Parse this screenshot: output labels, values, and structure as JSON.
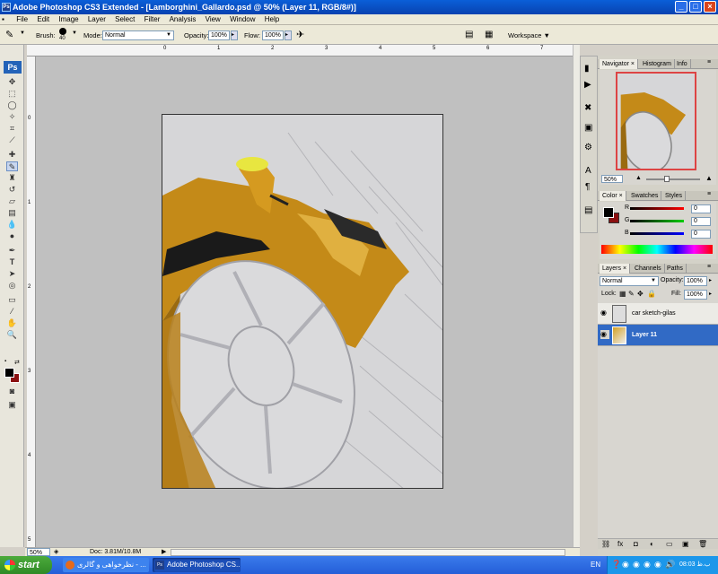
{
  "window": {
    "title": "Adobe Photoshop CS3 Extended - [Lamborghini_Gallardo.psd @ 50% (Layer 11, RGB/8#)]"
  },
  "menu": [
    "File",
    "Edit",
    "Image",
    "Layer",
    "Select",
    "Filter",
    "Analysis",
    "View",
    "Window",
    "Help"
  ],
  "options": {
    "brush_label": "Brush:",
    "brush_size": "40",
    "mode_label": "Mode:",
    "mode_value": "Normal",
    "opacity_label": "Opacity:",
    "opacity_value": "100%",
    "flow_label": "Flow:",
    "flow_value": "100%",
    "workspace_label": "Workspace ▼"
  },
  "toolbox": {
    "ps_logo": "Ps"
  },
  "rulers": {
    "top": [
      "0",
      "1",
      "2",
      "3",
      "4",
      "5",
      "6",
      "7"
    ],
    "left": [
      "0",
      "1",
      "2",
      "3",
      "4",
      "5"
    ]
  },
  "status": {
    "zoom": "50%",
    "doc": "Doc: 3.81M/10.8M"
  },
  "navigator": {
    "tabs": [
      "Navigator",
      "Histogram",
      "Info"
    ],
    "zoom": "50%"
  },
  "color_panel": {
    "tabs": [
      "Color",
      "Swatches",
      "Styles"
    ],
    "channels": [
      {
        "label": "R",
        "value": "0",
        "color": "#cc0000"
      },
      {
        "label": "G",
        "value": "0",
        "color": "#00a000"
      },
      {
        "label": "B",
        "value": "0",
        "color": "#0000cc"
      }
    ]
  },
  "layers_panel": {
    "tabs": [
      "Layers",
      "Channels",
      "Paths"
    ],
    "blend_mode": "Normal",
    "opacity_label": "Opacity:",
    "opacity_value": "100%",
    "lock_label": "Lock:",
    "fill_label": "Fill:",
    "fill_value": "100%",
    "layers": [
      {
        "name": "car sketch-gilas",
        "selected": false
      },
      {
        "name": "Layer 11",
        "selected": true
      }
    ]
  },
  "taskbar": {
    "start": "start",
    "tasks": [
      "نظرخواهی و گالری - ...",
      "Adobe Photoshop CS..."
    ],
    "lang": "EN",
    "clock": "08:03 ب.ظ"
  },
  "colors": {
    "accent": "#316ac5",
    "car_orange": "#d4a024",
    "foreground": "#000000",
    "background": "#8b1010"
  }
}
